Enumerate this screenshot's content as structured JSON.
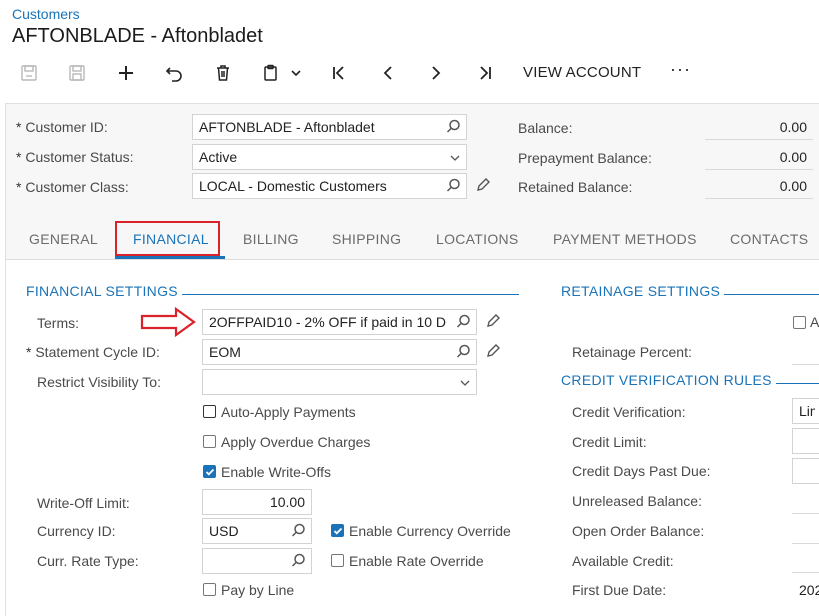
{
  "header": {
    "breadcrumb": "Customers",
    "title": "AFTONBLADE - Aftonbladet"
  },
  "toolbar": {
    "view_account": "VIEW ACCOUNT",
    "more": "···"
  },
  "summary": {
    "customer_id_label": "Customer ID:",
    "customer_id_value": "AFTONBLADE - Aftonbladet",
    "customer_status_label": "Customer Status:",
    "customer_status_value": "Active",
    "customer_class_label": "Customer Class:",
    "customer_class_value": "LOCAL - Domestic Customers",
    "balance_label": "Balance:",
    "balance_value": "0.00",
    "prepayment_label": "Prepayment Balance:",
    "prepayment_value": "0.00",
    "retained_label": "Retained Balance:",
    "retained_value": "0.00",
    "required_mark": "*"
  },
  "tabs": {
    "general": "GENERAL",
    "financial": "FINANCIAL",
    "billing": "BILLING",
    "shipping": "SHIPPING",
    "locations": "LOCATIONS",
    "payment_methods": "PAYMENT METHODS",
    "contacts": "CONTACTS"
  },
  "financial": {
    "section_title": "FINANCIAL SETTINGS",
    "terms_label": "Terms:",
    "terms_value": "2OFFPAID10 - 2% OFF if paid in 10 D",
    "statement_cycle_label": "Statement Cycle ID:",
    "statement_cycle_value": "EOM",
    "restrict_label": "Restrict Visibility To:",
    "restrict_value": "",
    "auto_apply_label": "Auto-Apply Payments",
    "apply_overdue_label": "Apply Overdue Charges",
    "enable_writeoffs_label": "Enable Write-Offs",
    "writeoff_limit_label": "Write-Off Limit:",
    "writeoff_limit_value": "10.00",
    "currency_label": "Currency ID:",
    "currency_value": "USD",
    "enable_currency_override_label": "Enable Currency Override",
    "rate_type_label": "Curr. Rate Type:",
    "rate_type_value": "",
    "enable_rate_override_label": "Enable Rate Override",
    "pay_by_line_label": "Pay by Line"
  },
  "retainage": {
    "section_title": "RETAINAGE SETTINGS",
    "checkbox_label": "A",
    "percent_label": "Retainage Percent:"
  },
  "credit": {
    "section_title": "CREDIT VERIFICATION RULES",
    "verification_label": "Credit Verification:",
    "verification_value": "Lim",
    "limit_label": "Credit Limit:",
    "days_past_due_label": "Credit Days Past Due:",
    "unreleased_label": "Unreleased Balance:",
    "open_order_label": "Open Order Balance:",
    "available_label": "Available Credit:",
    "first_due_label": "First Due Date:",
    "first_due_value": "202"
  },
  "checkboxes": {
    "auto_apply": false,
    "apply_overdue": false,
    "enable_writeoffs": true,
    "enable_currency_override": true,
    "enable_rate_override": false,
    "pay_by_line": false,
    "retainage_apply": false
  },
  "colors": {
    "accent": "#1a73b8",
    "annotation_red": "#d9222a"
  }
}
